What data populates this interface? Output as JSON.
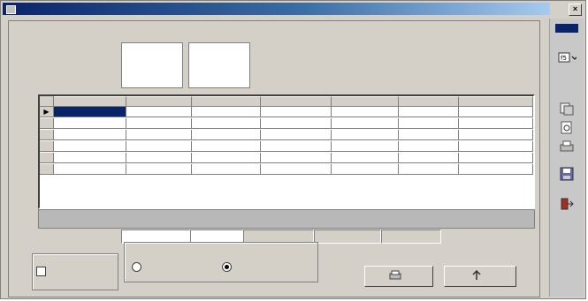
{
  "window": {
    "title": ""
  },
  "tabs": [
    {
      "label": ""
    },
    {
      "label": ""
    }
  ],
  "grid": {
    "columns": [
      "",
      "",
      "",
      "",
      "",
      "",
      ""
    ],
    "rows": [
      {
        "cells": [
          "",
          "",
          "",
          "",
          "",
          "",
          ""
        ]
      },
      {
        "cells": [
          "",
          "",
          "",
          "",
          "",
          "",
          ""
        ]
      },
      {
        "cells": [
          "",
          "",
          "",
          "",
          "",
          "",
          ""
        ]
      },
      {
        "cells": [
          "",
          "",
          "",
          "",
          "",
          "",
          ""
        ]
      },
      {
        "cells": [
          "",
          "",
          "",
          "",
          "",
          "",
          ""
        ]
      },
      {
        "cells": [
          "",
          "",
          "",
          "",
          "",
          "",
          ""
        ]
      }
    ]
  },
  "totals": [
    "",
    "",
    "",
    "",
    ""
  ],
  "options": {
    "checkbox_label": "",
    "group_label": "",
    "radio1_label": "",
    "radio2_label": ""
  },
  "buttons": {
    "print": "",
    "exit": ""
  },
  "sidebar": [
    "window-list-icon",
    "calculator-icon",
    "copy-icon",
    "preview-icon",
    "save-icon",
    "exit-icon"
  ],
  "colors": {
    "titlebar": "#0a246a",
    "selection": "#0a246a",
    "panel": "#d4d0c8"
  }
}
